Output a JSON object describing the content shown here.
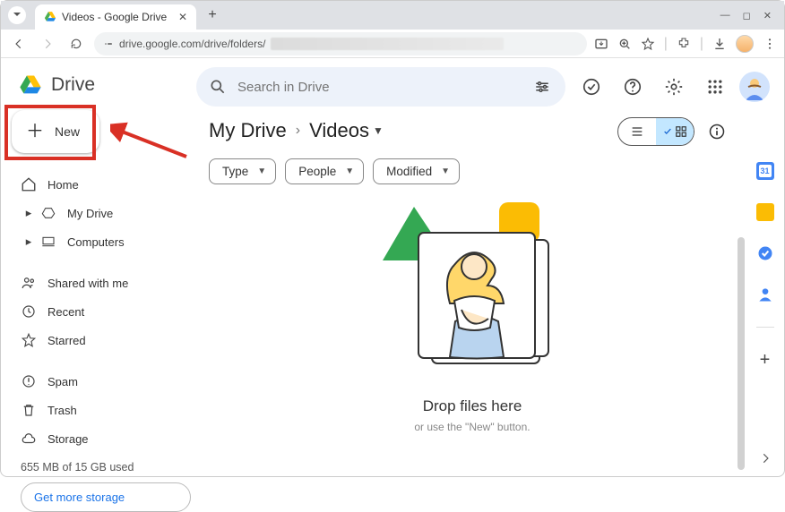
{
  "browser": {
    "tab_title": "Videos - Google Drive",
    "url_prefix": "drive.google.com/drive/folders/"
  },
  "app": {
    "logo_text": "Drive",
    "new_button": "New",
    "search_placeholder": "Search in Drive",
    "nav": {
      "home": "Home",
      "my_drive": "My Drive",
      "computers": "Computers",
      "shared": "Shared with me",
      "recent": "Recent",
      "starred": "Starred",
      "spam": "Spam",
      "trash": "Trash",
      "storage": "Storage"
    },
    "storage_usage": "655 MB of 15 GB used",
    "storage_cta": "Get more storage"
  },
  "breadcrumb": {
    "root": "My Drive",
    "current": "Videos"
  },
  "filters": {
    "type": "Type",
    "people": "People",
    "modified": "Modified"
  },
  "empty": {
    "title": "Drop files here",
    "subtitle": "or use the \"New\" button."
  }
}
